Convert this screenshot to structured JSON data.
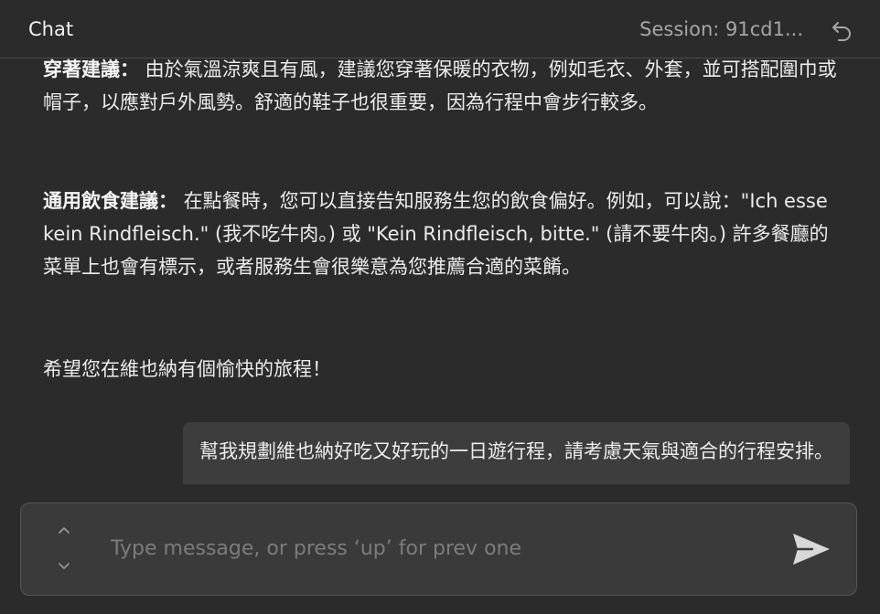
{
  "header": {
    "title": "Chat",
    "session": "Session: 91cd1..."
  },
  "messages": {
    "attire": {
      "heading": "穿著建議：",
      "body": " 由於氣溫涼爽且有風，建議您穿著保暖的衣物，例如毛衣、外套，並可搭配圍巾或帽子，以應對戶外風勢。舒適的鞋子也很重要，因為行程中會步行較多。"
    },
    "diet": {
      "heading": "通用飲食建議：",
      "body": " 在點餐時，您可以直接告知服務生您的飲食偏好。例如，可以說：\"Ich esse kein Rindfleisch.\" (我不吃牛肉。) 或 \"Kein Rindfleisch, bitte.\" (請不要牛肉。) 許多餐廳的菜單上也會有標示，或者服務生會很樂意為您推薦合適的菜餚。"
    },
    "closing": "希望您在維也納有個愉快的旅程！",
    "user_message": "幫我規劃維也納好吃又好玩的一日遊行程，請考慮天氣與適合的行程安排。"
  },
  "input": {
    "placeholder": "Type message, or press ‘up’ for prev one",
    "value": ""
  },
  "icons": {
    "undo": "undo-icon",
    "history_up": "chevron-up-icon",
    "history_down": "chevron-down-icon",
    "send": "send-icon"
  },
  "colors": {
    "background": "#2b2b2b",
    "input_background": "#3a3a3a",
    "user_bubble": "#3d3d3d",
    "text": "#ececec",
    "muted": "#a6a6a6"
  }
}
